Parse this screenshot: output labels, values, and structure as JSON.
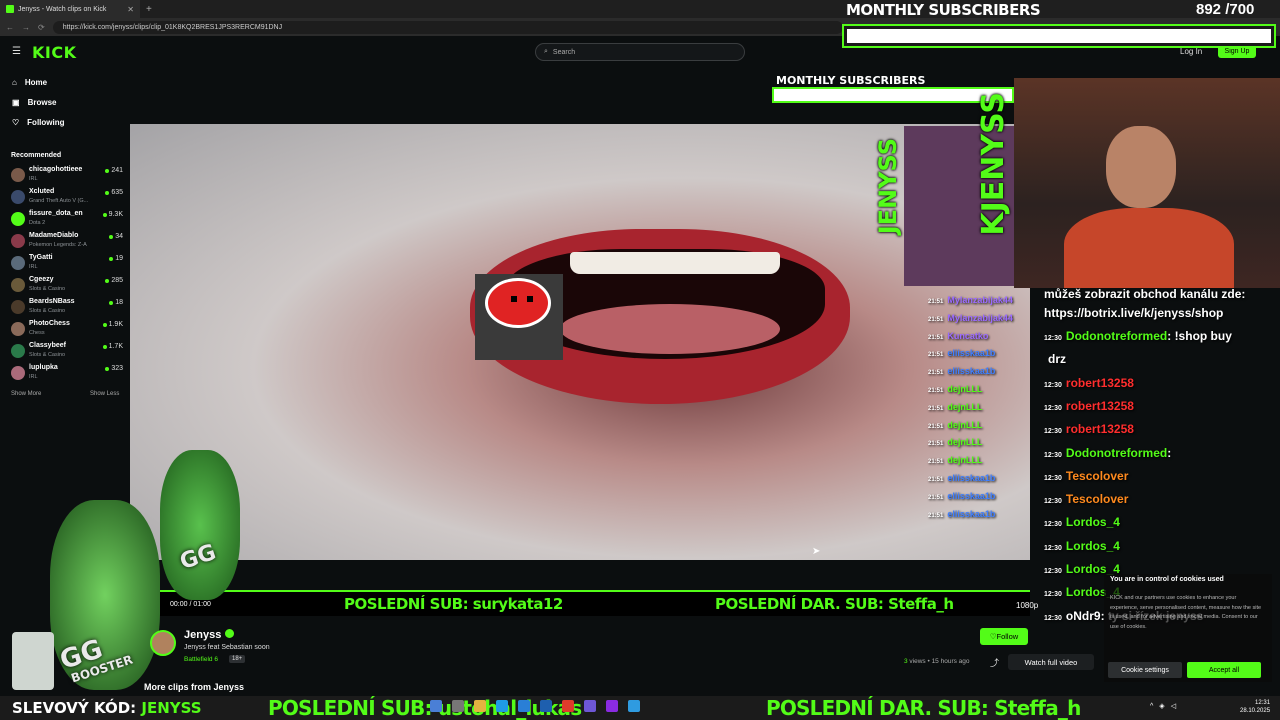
{
  "browser": {
    "tab_title": "Jenyss - Watch clips on Kick",
    "url": "https://kick.com/jenyss/clips/clip_01K8KQ2BRES1JPS3RERCM91DNJ"
  },
  "nav": {
    "logo": "KICK",
    "search_placeholder": "Search",
    "login": "Log In",
    "signup": "Sign Up"
  },
  "sidebar": {
    "menu": [
      {
        "label": "Home",
        "icon": "home-icon"
      },
      {
        "label": "Browse",
        "icon": "browse-icon"
      },
      {
        "label": "Following",
        "icon": "heart-icon"
      }
    ],
    "recommended_title": "Recommended",
    "channels": [
      {
        "name": "chicagohottieee",
        "category": "IRL",
        "viewers": "241",
        "color": "#7a5a4a"
      },
      {
        "name": "Xcluted",
        "category": "Grand Theft Auto V (G...",
        "viewers": "635",
        "color": "#3a4a6b"
      },
      {
        "name": "fissure_dota_en",
        "category": "Dota 2",
        "viewers": "9.3K",
        "color": "#53fc18"
      },
      {
        "name": "MadameDiablo",
        "category": "Pokemon Legends: Z-A",
        "viewers": "34",
        "color": "#8a3a4a"
      },
      {
        "name": "TyGatti",
        "category": "IRL",
        "viewers": "19",
        "color": "#5a6a7a"
      },
      {
        "name": "Cgeezy",
        "category": "Slots & Casino",
        "viewers": "285",
        "color": "#6a5a3a"
      },
      {
        "name": "BeardsNBass",
        "category": "Slots & Casino",
        "viewers": "18",
        "color": "#4a3a2a"
      },
      {
        "name": "PhotoChess",
        "category": "Chess",
        "viewers": "1.9K",
        "color": "#8a6a5a"
      },
      {
        "name": "Classybeef",
        "category": "Slots & Casino",
        "viewers": "1.7K",
        "color": "#2a7a4a"
      },
      {
        "name": "luplupka",
        "category": "IRL",
        "viewers": "323",
        "color": "#aa6a7a"
      }
    ],
    "show_more": "Show More",
    "show_less": "Show Less"
  },
  "overlay": {
    "monthly_subs_label": "MONTHLY SUBSCRIBERS",
    "monthly_subs_count": "892  /700",
    "monthly_subs_label_small": "MONTHLY SUBSCRIBERS",
    "brand_vertical": "JENYSS",
    "brand_vertical_2": "KJENYSS",
    "ticker_top": [
      "POSLEDNÍ SUB: surykata12",
      "POSLEDNÍ DAR. SUB: Steffa_h"
    ],
    "ticker_bottom": [
      "POSLEDNÍ SUB: ustohal_lukas",
      "POSLEDNÍ DAR. SUB: Steffa_h"
    ],
    "promo_prefix": "SLEVOVÝ KÓD:",
    "promo_code": "JENYSS",
    "booster_text": "BOOSTER",
    "booster_logo": "GG"
  },
  "chat_left": [
    {
      "time": "21:51",
      "user": "Mylanzabijak44",
      "color": "c-purple"
    },
    {
      "time": "21:51",
      "user": "Mylanzabijak44",
      "color": "c-purple"
    },
    {
      "time": "21:51",
      "user": "Kuncatko",
      "color": "c-purple"
    },
    {
      "time": "21:51",
      "user": "eliisskaa1b",
      "color": "c-blue"
    },
    {
      "time": "21:51",
      "user": "eliisskaa1b",
      "color": "c-blue"
    },
    {
      "time": "21:51",
      "user": "dejnLLL",
      "color": "c-green"
    },
    {
      "time": "21:51",
      "user": "dejnLLL",
      "color": "c-green"
    },
    {
      "time": "21:51",
      "user": "dejnLLL",
      "color": "c-green"
    },
    {
      "time": "21:51",
      "user": "dejnLLL",
      "color": "c-green"
    },
    {
      "time": "21:51",
      "user": "dejnLLL",
      "color": "c-green"
    },
    {
      "time": "21:51",
      "user": "eliisskaa1b",
      "color": "c-blue"
    },
    {
      "time": "21:51",
      "user": "eliisskaa1b",
      "color": "c-blue"
    },
    {
      "time": "21:51",
      "user": "eliisskaa1b",
      "color": "c-blue"
    }
  ],
  "chat_right": {
    "info_line1": "můžeš zobrazit obchod kanálu zde:",
    "info_line2": "https://botrix.live/k/jenyss/shop",
    "messages": [
      {
        "time": "12:30",
        "user": "Dodonotreformed",
        "text": ": !shop buy",
        "color": "c-green"
      },
      {
        "time": "",
        "user": "",
        "text": "drz",
        "color": "c-white"
      },
      {
        "time": "12:30",
        "user": "robert13258",
        "text": "",
        "color": "c-red"
      },
      {
        "time": "12:30",
        "user": "robert13258",
        "text": "",
        "color": "c-red"
      },
      {
        "time": "12:30",
        "user": "robert13258",
        "text": "",
        "color": "c-red"
      },
      {
        "time": "12:30",
        "user": "Dodonotreformed",
        "text": ":",
        "color": "c-green"
      },
      {
        "time": "12:30",
        "user": "Tescolover",
        "text": "",
        "color": "c-orange"
      },
      {
        "time": "12:30",
        "user": "Tescolover",
        "text": "",
        "color": "c-orange"
      },
      {
        "time": "12:30",
        "user": "Lordos_4",
        "text": "",
        "color": "c-green"
      },
      {
        "time": "12:30",
        "user": "Lordos_4",
        "text": "",
        "color": "c-green"
      },
      {
        "time": "12:30",
        "user": "Lordos_4",
        "text": "",
        "color": "c-green"
      },
      {
        "time": "12:30",
        "user": "Lordos_4",
        "text": "",
        "color": "c-green"
      },
      {
        "time": "12:30",
        "user": "oNdr9",
        "text": ": ty si řízek jenyss",
        "color": "c-white"
      }
    ]
  },
  "video": {
    "controls_left": "00:00 / 01:00",
    "controls_right": "1080p"
  },
  "clip": {
    "streamer": "Jenyss",
    "title": "Jenyss feat Sebastian soon",
    "category": "Battlefield 6",
    "age_badge": "18+",
    "follow": "Follow",
    "views_count": "3",
    "views_suffix": " views • 15 hours ago",
    "watch_full": "Watch full video",
    "more_clips": "More clips from Jenyss"
  },
  "cookies": {
    "title": "You are in control of cookies used",
    "body": "KICK and our partners use cookies to enhance your experience, serve personalised content, measure how the site is used, and for advertising and social media. Consent to our use of cookies.",
    "settings": "Cookie settings",
    "accept": "Accept all"
  },
  "taskbar": {
    "time": "12:31",
    "date": "28.10.2025"
  }
}
